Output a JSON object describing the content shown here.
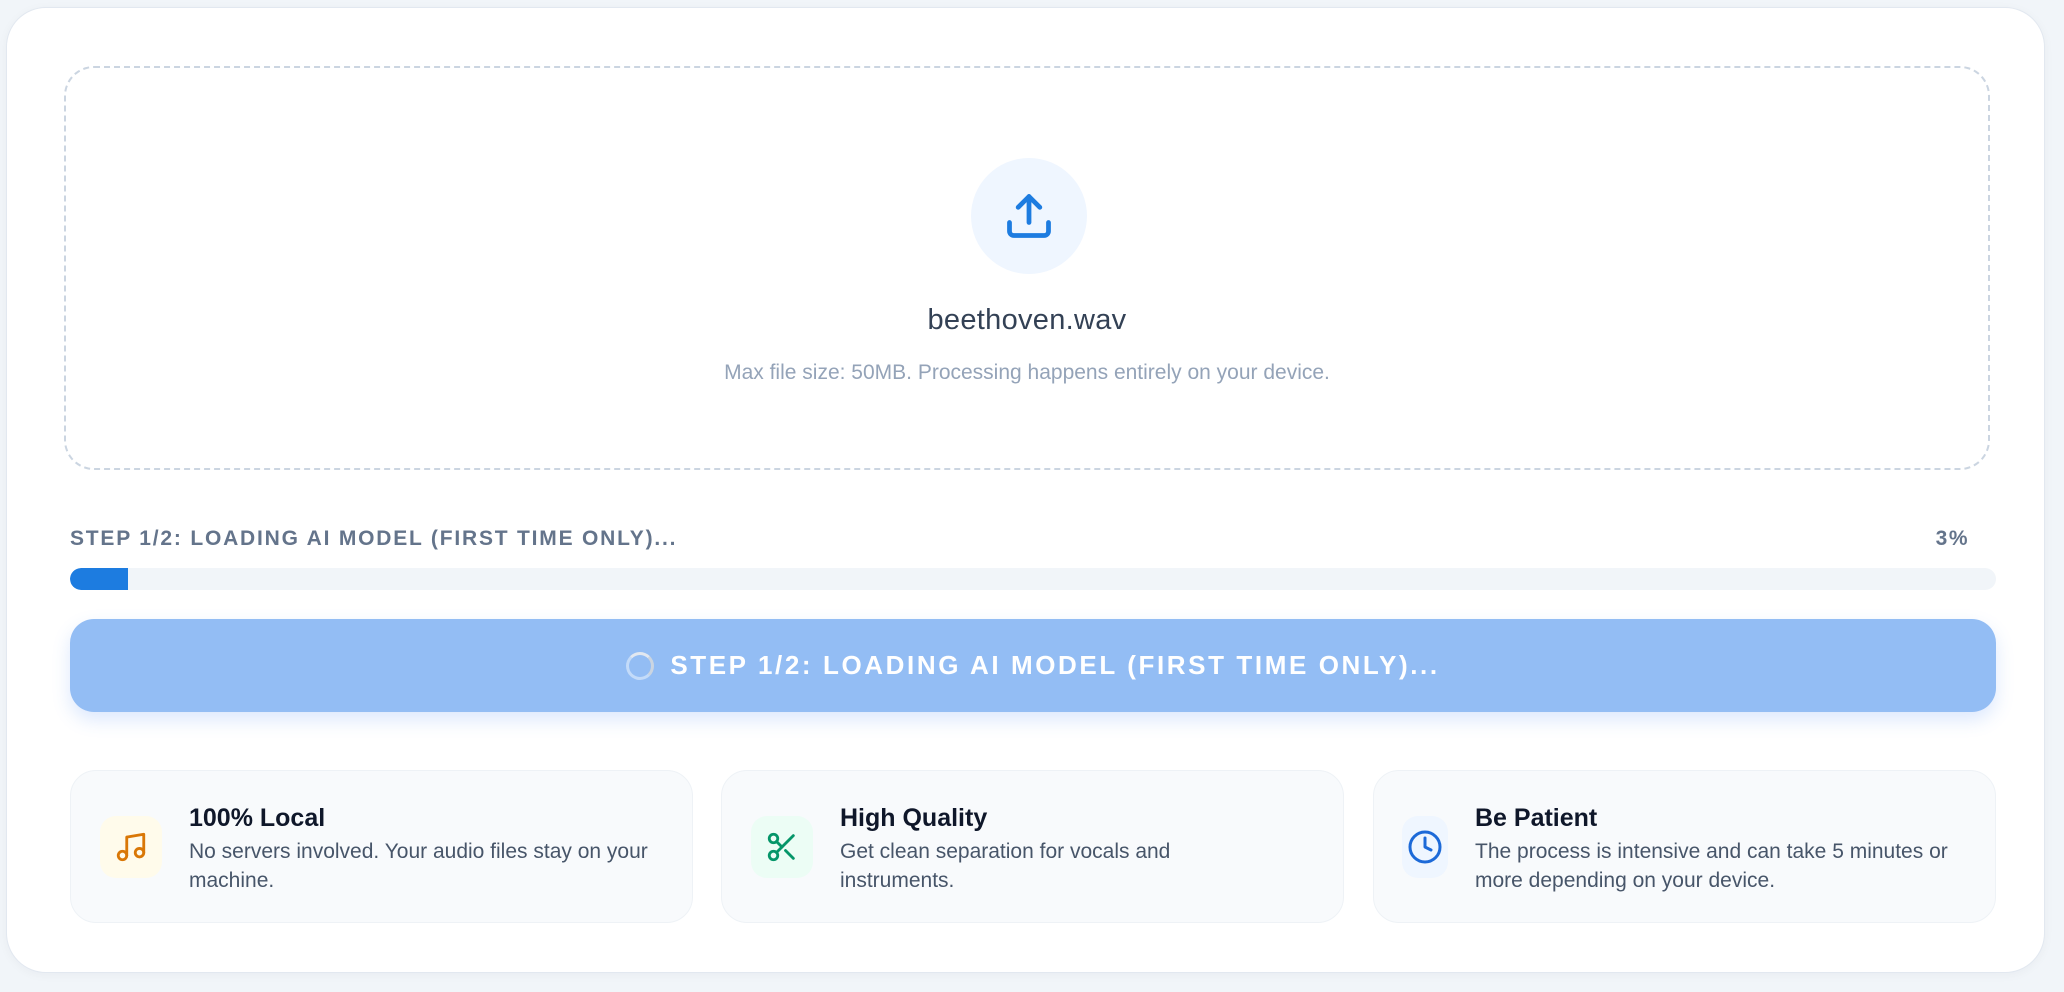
{
  "upload": {
    "icon": "upload-icon",
    "file_name": "beethoven.wav",
    "hint": "Max file size: 50MB. Processing happens entirely on your device."
  },
  "progress": {
    "label": "STEP 1/2: LOADING AI MODEL (FIRST TIME ONLY)...",
    "percent_label": "3%",
    "percent": 3,
    "fill_color": "#1d7ce0"
  },
  "action": {
    "label": "STEP 1/2: LOADING AI MODEL (FIRST TIME ONLY)...",
    "icon": "spinner-icon",
    "color": "#93bdf4"
  },
  "features": [
    {
      "icon": "music-note-icon",
      "icon_color": "#d97706",
      "icon_bg": "#fffbeb",
      "title": "100% Local",
      "description": "No servers involved. Your audio files stay on your machine."
    },
    {
      "icon": "scissors-icon",
      "icon_color": "#059669",
      "icon_bg": "#ecfdf5",
      "title": "High Quality",
      "description": "Get clean separation for vocals and instruments."
    },
    {
      "icon": "clock-icon",
      "icon_color": "#1d6ad8",
      "icon_bg": "#eff6ff",
      "title": "Be Patient",
      "description": "The process is intensive and can take 5 minutes or more depending on your device."
    }
  ]
}
